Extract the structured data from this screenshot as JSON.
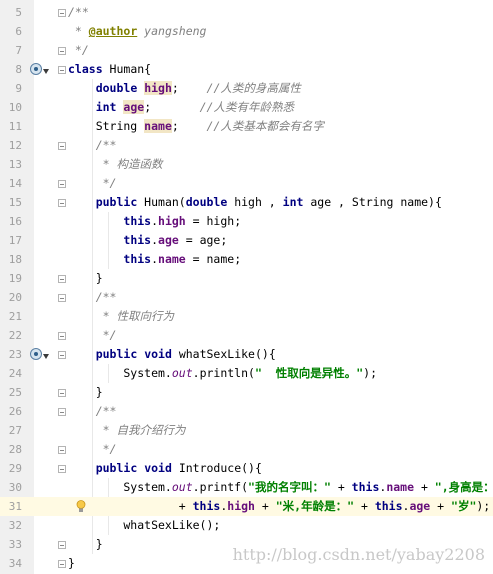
{
  "editor": {
    "colors": {
      "keyword": "#000080",
      "field": "#660e7a",
      "comment": "#808080",
      "string": "#008000",
      "annotation": "#808000",
      "line_number": "#9e9e9e",
      "current_line": "#fffae3"
    },
    "gutter_icons": [
      "implements-method-icon",
      "implements-method-icon",
      "lightbulb-icon"
    ],
    "lines": [
      {
        "n": "5",
        "tokens": [
          [
            "cmt",
            "/**"
          ]
        ]
      },
      {
        "n": "6",
        "tokens": [
          [
            "cmt",
            " * "
          ],
          [
            "ann",
            "@author"
          ],
          [
            "cmt",
            " yangsheng"
          ]
        ]
      },
      {
        "n": "7",
        "tokens": [
          [
            "cmt",
            " */"
          ]
        ]
      },
      {
        "n": "8",
        "tokens": [
          [
            "kw",
            "class"
          ],
          [
            "p",
            " Human{"
          ]
        ]
      },
      {
        "n": "9",
        "tokens": [
          [
            "p",
            "    "
          ],
          [
            "kw",
            "double"
          ],
          [
            "p",
            " "
          ],
          [
            "hlfld",
            "high"
          ],
          [
            "p",
            ";    "
          ],
          [
            "cmt",
            "//人类的身高属性"
          ]
        ]
      },
      {
        "n": "10",
        "tokens": [
          [
            "p",
            "    "
          ],
          [
            "kw",
            "int"
          ],
          [
            "p",
            " "
          ],
          [
            "hlfld",
            "age"
          ],
          [
            "p",
            ";       "
          ],
          [
            "cmt",
            "//人类有年龄熟悉"
          ]
        ]
      },
      {
        "n": "11",
        "tokens": [
          [
            "p",
            "    String "
          ],
          [
            "hlfld",
            "name"
          ],
          [
            "p",
            ";    "
          ],
          [
            "cmt",
            "//人类基本都会有名字"
          ]
        ]
      },
      {
        "n": "12",
        "tokens": [
          [
            "cmt",
            "    /**"
          ]
        ]
      },
      {
        "n": "13",
        "tokens": [
          [
            "cmt",
            "     * 构造函数"
          ]
        ]
      },
      {
        "n": "14",
        "tokens": [
          [
            "cmt",
            "     */"
          ]
        ]
      },
      {
        "n": "15",
        "tokens": [
          [
            "p",
            "    "
          ],
          [
            "kw",
            "public"
          ],
          [
            "p",
            " Human("
          ],
          [
            "kw",
            "double"
          ],
          [
            "p",
            " high , "
          ],
          [
            "kw",
            "int"
          ],
          [
            "p",
            " age , String name){"
          ]
        ]
      },
      {
        "n": "16",
        "tokens": [
          [
            "p",
            "        "
          ],
          [
            "kw",
            "this"
          ],
          [
            "p",
            "."
          ],
          [
            "fld",
            "high"
          ],
          [
            "p",
            " = high;"
          ]
        ]
      },
      {
        "n": "17",
        "tokens": [
          [
            "p",
            "        "
          ],
          [
            "kw",
            "this"
          ],
          [
            "p",
            "."
          ],
          [
            "fld",
            "age"
          ],
          [
            "p",
            " = age;"
          ]
        ]
      },
      {
        "n": "18",
        "tokens": [
          [
            "p",
            "        "
          ],
          [
            "kw",
            "this"
          ],
          [
            "p",
            "."
          ],
          [
            "fld",
            "name"
          ],
          [
            "p",
            " = name;"
          ]
        ]
      },
      {
        "n": "19",
        "tokens": [
          [
            "p",
            "    }"
          ]
        ]
      },
      {
        "n": "20",
        "tokens": [
          [
            "cmt",
            "    /**"
          ]
        ]
      },
      {
        "n": "21",
        "tokens": [
          [
            "cmt",
            "     * 性取向行为"
          ]
        ]
      },
      {
        "n": "22",
        "tokens": [
          [
            "cmt",
            "     */"
          ]
        ]
      },
      {
        "n": "23",
        "tokens": [
          [
            "p",
            "    "
          ],
          [
            "kw",
            "public"
          ],
          [
            "p",
            " "
          ],
          [
            "kw",
            "void"
          ],
          [
            "p",
            " whatSexLike(){"
          ]
        ]
      },
      {
        "n": "24",
        "tokens": [
          [
            "p",
            "        System."
          ],
          [
            "static",
            "out"
          ],
          [
            "p",
            ".println("
          ],
          [
            "str",
            "\"  性取向是异性。\""
          ],
          [
            "p",
            ");"
          ]
        ]
      },
      {
        "n": "25",
        "tokens": [
          [
            "p",
            "    }"
          ]
        ]
      },
      {
        "n": "26",
        "tokens": [
          [
            "cmt",
            "    /**"
          ]
        ]
      },
      {
        "n": "27",
        "tokens": [
          [
            "cmt",
            "     * 自我介绍行为"
          ]
        ]
      },
      {
        "n": "28",
        "tokens": [
          [
            "cmt",
            "     */"
          ]
        ]
      },
      {
        "n": "29",
        "tokens": [
          [
            "p",
            "    "
          ],
          [
            "kw",
            "public"
          ],
          [
            "p",
            " "
          ],
          [
            "kw",
            "void"
          ],
          [
            "p",
            " Introduce(){"
          ]
        ]
      },
      {
        "n": "30",
        "tokens": [
          [
            "p",
            "        System."
          ],
          [
            "static",
            "out"
          ],
          [
            "p",
            ".printf("
          ],
          [
            "str",
            "\"我的名字叫：\""
          ],
          [
            "p",
            " + "
          ],
          [
            "kw",
            "this"
          ],
          [
            "p",
            "."
          ],
          [
            "fld",
            "name"
          ],
          [
            "p",
            " + "
          ],
          [
            "str",
            "\",身高是：\""
          ]
        ]
      },
      {
        "n": "31",
        "tokens": [
          [
            "p",
            "                + "
          ],
          [
            "kw",
            "this"
          ],
          [
            "p",
            "."
          ],
          [
            "fld",
            "high"
          ],
          [
            "p",
            " + "
          ],
          [
            "str",
            "\"米,年龄是：\""
          ],
          [
            "p",
            " + "
          ],
          [
            "kw",
            "this"
          ],
          [
            "p",
            "."
          ],
          [
            "fld",
            "age"
          ],
          [
            "p",
            " + "
          ],
          [
            "str",
            "\"岁\""
          ],
          [
            "p",
            ");"
          ]
        ]
      },
      {
        "n": "32",
        "tokens": [
          [
            "p",
            "        whatSexLike();"
          ]
        ]
      },
      {
        "n": "33",
        "tokens": [
          [
            "p",
            "    }"
          ]
        ]
      },
      {
        "n": "34",
        "tokens": [
          [
            "p",
            "}"
          ]
        ]
      }
    ],
    "watermark": "http://blog.csdn.net/yabay2208"
  }
}
